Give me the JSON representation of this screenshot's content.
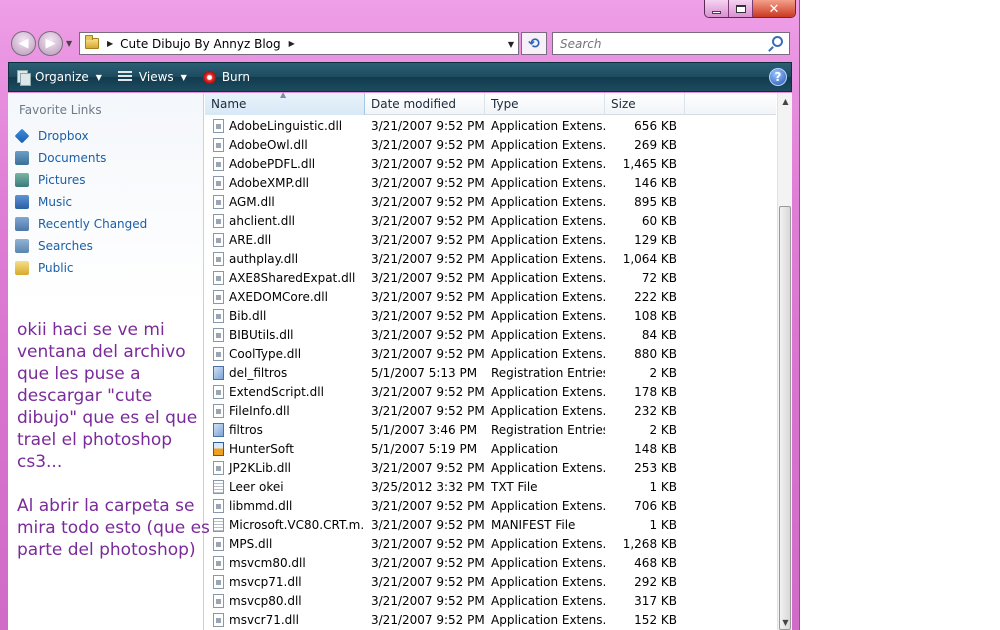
{
  "window": {
    "controls": {
      "minimize": "",
      "maximize": "",
      "close": "✕"
    }
  },
  "address": {
    "crumbs": [
      "Cute Dibujo By Annyz Blog"
    ]
  },
  "search": {
    "placeholder": "Search"
  },
  "toolbar": {
    "organize": "Organize",
    "views": "Views",
    "burn": "Burn",
    "help": "?"
  },
  "nav_pane": {
    "title": "Favorite Links",
    "items": [
      {
        "label": "Dropbox",
        "icon": "dropbox-icon"
      },
      {
        "label": "Documents",
        "icon": "documents-icon"
      },
      {
        "label": "Pictures",
        "icon": "pictures-icon"
      },
      {
        "label": "Music",
        "icon": "music-icon"
      },
      {
        "label": "Recently Changed",
        "icon": "recent-icon"
      },
      {
        "label": "Searches",
        "icon": "searches-icon"
      },
      {
        "label": "Public",
        "icon": "public-folder-icon"
      }
    ]
  },
  "note": {
    "paragraph1": "okii haci se ve mi ventana del archivo que les puse a descargar \"cute dibujo\" que es el que trael el photoshop cs3...",
    "paragraph2": "Al abrir la carpeta se mira todo esto (que es parte del photoshop)"
  },
  "columns": {
    "name": "Name",
    "date": "Date modified",
    "type": "Type",
    "size": "Size"
  },
  "files": [
    {
      "name": "AdobeLinguistic.dll",
      "date": "3/21/2007 9:52 PM",
      "type": "Application Extens...",
      "size": "656 KB",
      "kind": "dll"
    },
    {
      "name": "AdobeOwl.dll",
      "date": "3/21/2007 9:52 PM",
      "type": "Application Extens...",
      "size": "269 KB",
      "kind": "dll"
    },
    {
      "name": "AdobePDFL.dll",
      "date": "3/21/2007 9:52 PM",
      "type": "Application Extens...",
      "size": "1,465 KB",
      "kind": "dll"
    },
    {
      "name": "AdobeXMP.dll",
      "date": "3/21/2007 9:52 PM",
      "type": "Application Extens...",
      "size": "146 KB",
      "kind": "dll"
    },
    {
      "name": "AGM.dll",
      "date": "3/21/2007 9:52 PM",
      "type": "Application Extens...",
      "size": "895 KB",
      "kind": "dll"
    },
    {
      "name": "ahclient.dll",
      "date": "3/21/2007 9:52 PM",
      "type": "Application Extens...",
      "size": "60 KB",
      "kind": "dll"
    },
    {
      "name": "ARE.dll",
      "date": "3/21/2007 9:52 PM",
      "type": "Application Extens...",
      "size": "129 KB",
      "kind": "dll"
    },
    {
      "name": "authplay.dll",
      "date": "3/21/2007 9:52 PM",
      "type": "Application Extens...",
      "size": "1,064 KB",
      "kind": "dll"
    },
    {
      "name": "AXE8SharedExpat.dll",
      "date": "3/21/2007 9:52 PM",
      "type": "Application Extens...",
      "size": "72 KB",
      "kind": "dll"
    },
    {
      "name": "AXEDOMCore.dll",
      "date": "3/21/2007 9:52 PM",
      "type": "Application Extens...",
      "size": "222 KB",
      "kind": "dll"
    },
    {
      "name": "Bib.dll",
      "date": "3/21/2007 9:52 PM",
      "type": "Application Extens...",
      "size": "108 KB",
      "kind": "dll"
    },
    {
      "name": "BIBUtils.dll",
      "date": "3/21/2007 9:52 PM",
      "type": "Application Extens...",
      "size": "84 KB",
      "kind": "dll"
    },
    {
      "name": "CoolType.dll",
      "date": "3/21/2007 9:52 PM",
      "type": "Application Extens...",
      "size": "880 KB",
      "kind": "dll"
    },
    {
      "name": "del_filtros",
      "date": "5/1/2007 5:13 PM",
      "type": "Registration Entries",
      "size": "2 KB",
      "kind": "reg"
    },
    {
      "name": "ExtendScript.dll",
      "date": "3/21/2007 9:52 PM",
      "type": "Application Extens...",
      "size": "178 KB",
      "kind": "dll"
    },
    {
      "name": "FileInfo.dll",
      "date": "3/21/2007 9:52 PM",
      "type": "Application Extens...",
      "size": "232 KB",
      "kind": "dll"
    },
    {
      "name": "filtros",
      "date": "5/1/2007 3:46 PM",
      "type": "Registration Entries",
      "size": "2 KB",
      "kind": "reg"
    },
    {
      "name": "HunterSoft",
      "date": "5/1/2007 5:19 PM",
      "type": "Application",
      "size": "148 KB",
      "kind": "app"
    },
    {
      "name": "JP2KLib.dll",
      "date": "3/21/2007 9:52 PM",
      "type": "Application Extens...",
      "size": "253 KB",
      "kind": "dll"
    },
    {
      "name": "Leer okei",
      "date": "3/25/2012 3:32 PM",
      "type": "TXT File",
      "size": "1 KB",
      "kind": "txt"
    },
    {
      "name": "libmmd.dll",
      "date": "3/21/2007 9:52 PM",
      "type": "Application Extens...",
      "size": "706 KB",
      "kind": "dll"
    },
    {
      "name": "Microsoft.VC80.CRT.m...",
      "date": "3/21/2007 9:52 PM",
      "type": "MANIFEST File",
      "size": "1 KB",
      "kind": "txt"
    },
    {
      "name": "MPS.dll",
      "date": "3/21/2007 9:52 PM",
      "type": "Application Extens...",
      "size": "1,268 KB",
      "kind": "dll"
    },
    {
      "name": "msvcm80.dll",
      "date": "3/21/2007 9:52 PM",
      "type": "Application Extens...",
      "size": "468 KB",
      "kind": "dll"
    },
    {
      "name": "msvcp71.dll",
      "date": "3/21/2007 9:52 PM",
      "type": "Application Extens...",
      "size": "292 KB",
      "kind": "dll"
    },
    {
      "name": "msvcp80.dll",
      "date": "3/21/2007 9:52 PM",
      "type": "Application Extens...",
      "size": "317 KB",
      "kind": "dll"
    },
    {
      "name": "msvcr71.dll",
      "date": "3/21/2007 9:52 PM",
      "type": "Application Extens...",
      "size": "152 KB",
      "kind": "dll"
    }
  ],
  "colors": {
    "note_text": "#7a2a9a",
    "link_blue": "#1a5fa8",
    "toolbar": "#1d4b60",
    "frame_pink": "#e07fd6"
  }
}
